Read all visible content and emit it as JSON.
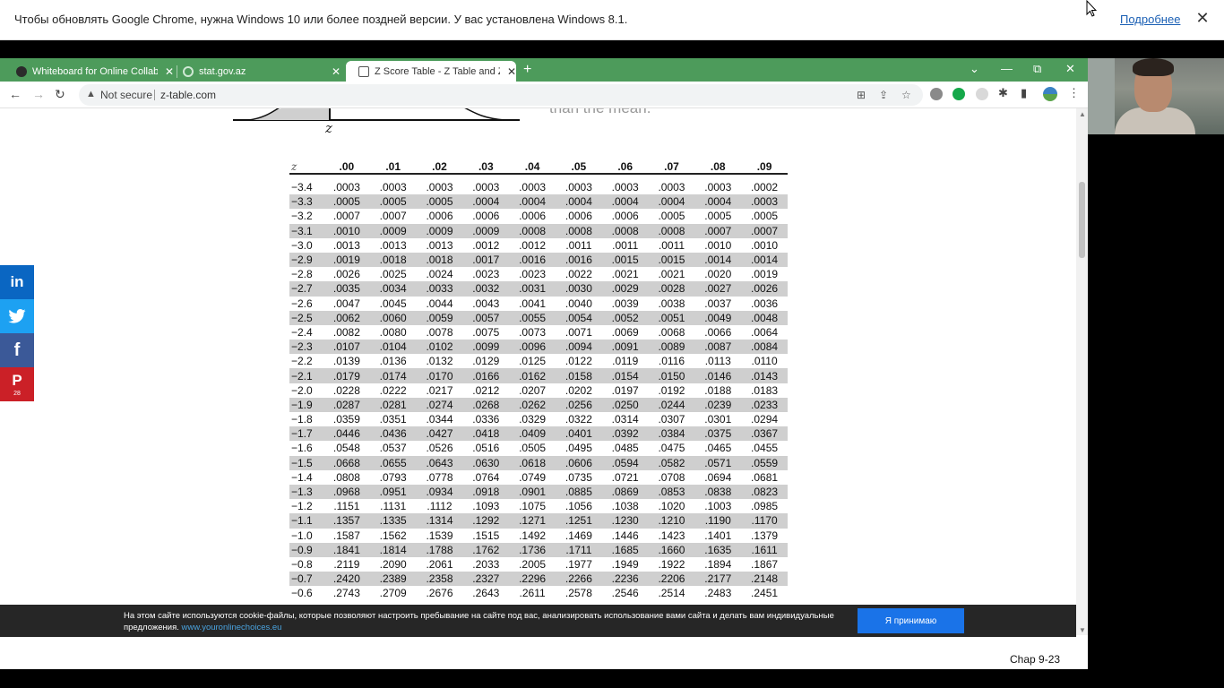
{
  "notification": {
    "message": "Чтобы обновлять Google Chrome, нужна Windows 10 или более поздней версии. У вас установлена Windows 8.1.",
    "link": "Подробнее",
    "close": "✕"
  },
  "tabs": [
    {
      "title": "Whiteboard for Online Collabora",
      "close": "✕"
    },
    {
      "title": "stat.gov.az",
      "close": "✕"
    },
    {
      "title": "Z Score Table - Z Table and Z sco",
      "close": "✕"
    }
  ],
  "new_tab": "+",
  "window_controls": {
    "dropdown": "⌄",
    "minimize": "—",
    "restore": "⧉",
    "close": "✕"
  },
  "nav": {
    "back": "←",
    "forward": "→",
    "reload": "↻"
  },
  "omnibox": {
    "security": "Not secure",
    "url": "z-table.com"
  },
  "page": {
    "z_label": "z",
    "mean_text": "than the mean."
  },
  "z_table": {
    "header": [
      "z",
      ".00",
      ".01",
      ".02",
      ".03",
      ".04",
      ".05",
      ".06",
      ".07",
      ".08",
      ".09"
    ],
    "rows": [
      [
        "−3.4",
        ".0003",
        ".0003",
        ".0003",
        ".0003",
        ".0003",
        ".0003",
        ".0003",
        ".0003",
        ".0003",
        ".0002"
      ],
      [
        "−3.3",
        ".0005",
        ".0005",
        ".0005",
        ".0004",
        ".0004",
        ".0004",
        ".0004",
        ".0004",
        ".0004",
        ".0003"
      ],
      [
        "−3.2",
        ".0007",
        ".0007",
        ".0006",
        ".0006",
        ".0006",
        ".0006",
        ".0006",
        ".0005",
        ".0005",
        ".0005"
      ],
      [
        "−3.1",
        ".0010",
        ".0009",
        ".0009",
        ".0009",
        ".0008",
        ".0008",
        ".0008",
        ".0008",
        ".0007",
        ".0007"
      ],
      [
        "−3.0",
        ".0013",
        ".0013",
        ".0013",
        ".0012",
        ".0012",
        ".0011",
        ".0011",
        ".0011",
        ".0010",
        ".0010"
      ],
      [
        "−2.9",
        ".0019",
        ".0018",
        ".0018",
        ".0017",
        ".0016",
        ".0016",
        ".0015",
        ".0015",
        ".0014",
        ".0014"
      ],
      [
        "−2.8",
        ".0026",
        ".0025",
        ".0024",
        ".0023",
        ".0023",
        ".0022",
        ".0021",
        ".0021",
        ".0020",
        ".0019"
      ],
      [
        "−2.7",
        ".0035",
        ".0034",
        ".0033",
        ".0032",
        ".0031",
        ".0030",
        ".0029",
        ".0028",
        ".0027",
        ".0026"
      ],
      [
        "−2.6",
        ".0047",
        ".0045",
        ".0044",
        ".0043",
        ".0041",
        ".0040",
        ".0039",
        ".0038",
        ".0037",
        ".0036"
      ],
      [
        "−2.5",
        ".0062",
        ".0060",
        ".0059",
        ".0057",
        ".0055",
        ".0054",
        ".0052",
        ".0051",
        ".0049",
        ".0048"
      ],
      [
        "−2.4",
        ".0082",
        ".0080",
        ".0078",
        ".0075",
        ".0073",
        ".0071",
        ".0069",
        ".0068",
        ".0066",
        ".0064"
      ],
      [
        "−2.3",
        ".0107",
        ".0104",
        ".0102",
        ".0099",
        ".0096",
        ".0094",
        ".0091",
        ".0089",
        ".0087",
        ".0084"
      ],
      [
        "−2.2",
        ".0139",
        ".0136",
        ".0132",
        ".0129",
        ".0125",
        ".0122",
        ".0119",
        ".0116",
        ".0113",
        ".0110"
      ],
      [
        "−2.1",
        ".0179",
        ".0174",
        ".0170",
        ".0166",
        ".0162",
        ".0158",
        ".0154",
        ".0150",
        ".0146",
        ".0143"
      ],
      [
        "−2.0",
        ".0228",
        ".0222",
        ".0217",
        ".0212",
        ".0207",
        ".0202",
        ".0197",
        ".0192",
        ".0188",
        ".0183"
      ],
      [
        "−1.9",
        ".0287",
        ".0281",
        ".0274",
        ".0268",
        ".0262",
        ".0256",
        ".0250",
        ".0244",
        ".0239",
        ".0233"
      ],
      [
        "−1.8",
        ".0359",
        ".0351",
        ".0344",
        ".0336",
        ".0329",
        ".0322",
        ".0314",
        ".0307",
        ".0301",
        ".0294"
      ],
      [
        "−1.7",
        ".0446",
        ".0436",
        ".0427",
        ".0418",
        ".0409",
        ".0401",
        ".0392",
        ".0384",
        ".0375",
        ".0367"
      ],
      [
        "−1.6",
        ".0548",
        ".0537",
        ".0526",
        ".0516",
        ".0505",
        ".0495",
        ".0485",
        ".0475",
        ".0465",
        ".0455"
      ],
      [
        "−1.5",
        ".0668",
        ".0655",
        ".0643",
        ".0630",
        ".0618",
        ".0606",
        ".0594",
        ".0582",
        ".0571",
        ".0559"
      ],
      [
        "−1.4",
        ".0808",
        ".0793",
        ".0778",
        ".0764",
        ".0749",
        ".0735",
        ".0721",
        ".0708",
        ".0694",
        ".0681"
      ],
      [
        "−1.3",
        ".0968",
        ".0951",
        ".0934",
        ".0918",
        ".0901",
        ".0885",
        ".0869",
        ".0853",
        ".0838",
        ".0823"
      ],
      [
        "−1.2",
        ".1151",
        ".1131",
        ".1112",
        ".1093",
        ".1075",
        ".1056",
        ".1038",
        ".1020",
        ".1003",
        ".0985"
      ],
      [
        "−1.1",
        ".1357",
        ".1335",
        ".1314",
        ".1292",
        ".1271",
        ".1251",
        ".1230",
        ".1210",
        ".1190",
        ".1170"
      ],
      [
        "−1.0",
        ".1587",
        ".1562",
        ".1539",
        ".1515",
        ".1492",
        ".1469",
        ".1446",
        ".1423",
        ".1401",
        ".1379"
      ],
      [
        "−0.9",
        ".1841",
        ".1814",
        ".1788",
        ".1762",
        ".1736",
        ".1711",
        ".1685",
        ".1660",
        ".1635",
        ".1611"
      ],
      [
        "−0.8",
        ".2119",
        ".2090",
        ".2061",
        ".2033",
        ".2005",
        ".1977",
        ".1949",
        ".1922",
        ".1894",
        ".1867"
      ],
      [
        "−0.7",
        ".2420",
        ".2389",
        ".2358",
        ".2327",
        ".2296",
        ".2266",
        ".2236",
        ".2206",
        ".2177",
        ".2148"
      ],
      [
        "−0.6",
        ".2743",
        ".2709",
        ".2676",
        ".2643",
        ".2611",
        ".2578",
        ".2546",
        ".2514",
        ".2483",
        ".2451"
      ]
    ],
    "shaded_rows": [
      1,
      3,
      5,
      7,
      9,
      11,
      13,
      15,
      17,
      19,
      21,
      23,
      25,
      27
    ]
  },
  "social": {
    "linkedin": "in",
    "twitter": "🐦",
    "facebook": "f",
    "pinterest": "P",
    "pinterest_count": "28"
  },
  "cookie": {
    "text": "На этом сайте используются cookie-файлы, которые позволяют настроить пребывание на сайте под вас, анализировать использование вами сайта и делать вам индивидуальные предложения.",
    "link": "www.youronlinechoices.eu",
    "accept": "Я принимаю"
  },
  "slide_footer": "Chap 9-23",
  "colors": {
    "tab_strip": "#4d9b5b",
    "row_shade": "#cfcfcf",
    "cookie_bg": "#262626",
    "cookie_button": "#1a73e8"
  }
}
